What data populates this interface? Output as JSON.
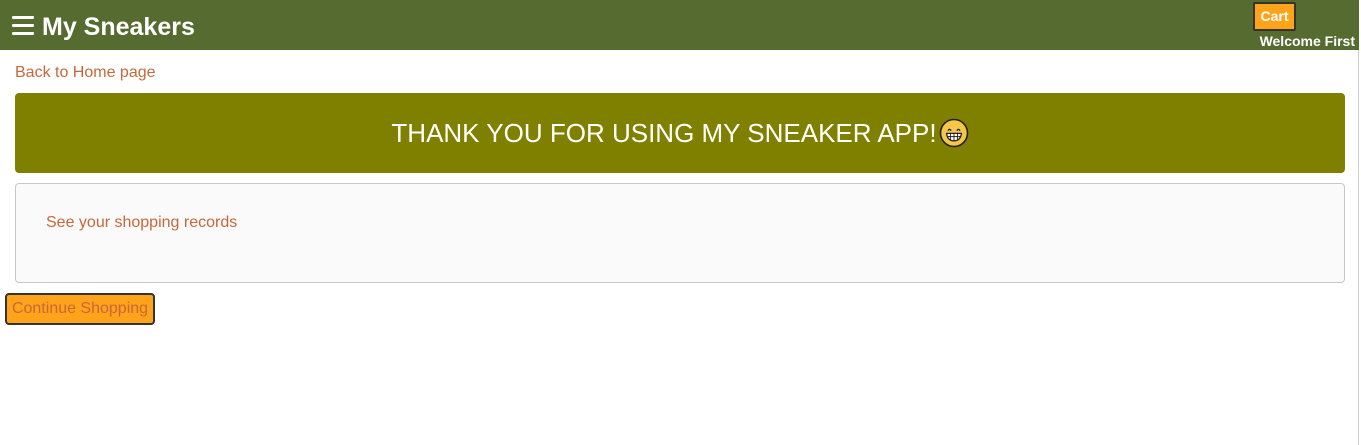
{
  "header": {
    "menu_icon": "hamburger-menu-icon",
    "brand": "My Sneakers",
    "cart_label": "Cart",
    "welcome_text": "Welcome First"
  },
  "navigation": {
    "back_link": "Back to Home page"
  },
  "banner": {
    "message": "THANK YOU FOR USING MY SNEAKER APP!",
    "emoji_icon": "grinning-face-icon"
  },
  "records": {
    "link_text": "See your shopping records"
  },
  "actions": {
    "continue_label": "Continue Shopping"
  },
  "colors": {
    "header_bg": "#556b2f",
    "banner_bg": "#808000",
    "accent_orange": "#ffa31a",
    "link": "#c8683a"
  }
}
